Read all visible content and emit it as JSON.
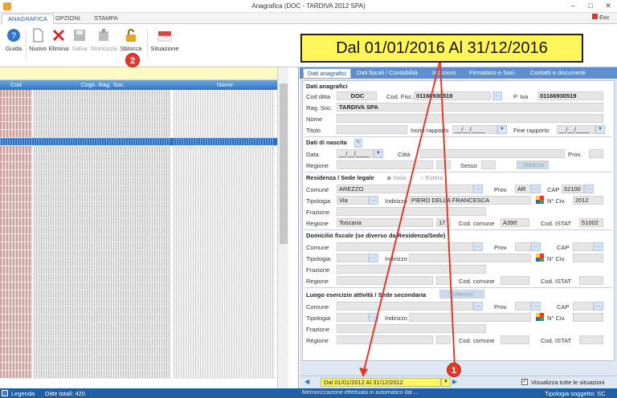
{
  "window": {
    "title": "Anagrafica (DOC - TARDIVA 2012 SPA)",
    "esc_label": "Esc"
  },
  "ribbon_tabs": [
    "ANAGRAFICA",
    "OPZIONI",
    "STAMPA"
  ],
  "ribbon_buttons": {
    "guida": "Guida",
    "nuovo": "Nuovo",
    "elimina": "Elimina",
    "salva": "Salva",
    "storicizza": "Storicizza",
    "sblocca": "Sblocca",
    "situazione": "Situazione"
  },
  "callout": {
    "text": "Dal 01/01/2016 Al 31/12/2016",
    "badge_1": "1",
    "badge_2": "2"
  },
  "grid": {
    "col_cod": "Cod",
    "col_rag": "Cogn. Rag. Soc.",
    "col_nome": "Nome"
  },
  "right_tabs": [
    "Dati anagrafici",
    "Dati fiscali / Contabilità",
    "Iscrizioni",
    "Firmatario e Soci",
    "Contatti e documenti"
  ],
  "dati_anagrafici": {
    "section": "Dati anagrafici",
    "cod_ditta_label": "Cod ditta",
    "cod_ditta": "DOC",
    "cod_fisc_label": "Cod. Fisc.",
    "cod_fisc": "01166930519",
    "piva_label": "P. Iva",
    "piva": "01166930519",
    "rag_soc_label": "Rag. Soc.",
    "rag_soc": "TARDIVA SPA",
    "nome_label": "Nome",
    "titolo_label": "Titolo",
    "inizio_label": "Inizio rapporto",
    "inizio_value": "__/__/____",
    "fine_label": "Fine rapporto",
    "fine_value": "__/__/____"
  },
  "nascita": {
    "section": "Dati di nascita",
    "data_label": "Data",
    "data_value": "__/__/____",
    "citta_label": "Città",
    "prov_label": "Prov.",
    "regione_label": "Regione",
    "sesso_label": "Sesso",
    "sblocca_btn": "Sblocca"
  },
  "residenza": {
    "section": "Residenza / Sede legale",
    "opt_italia": "Italia",
    "opt_estera": "Estera",
    "comune_label": "Comune",
    "comune": "AREZZO",
    "prov_label": "Prov.",
    "prov": "AR",
    "cap_label": "CAP",
    "cap": "52100",
    "tipologia_label": "Tipologia",
    "tipologia": "Via",
    "indirizzo_label": "Indirizzo",
    "indirizzo": "PIERO DELLA FRANCESCA",
    "civ_label": "N° Civ.",
    "civ": "2012",
    "frazione_label": "Frazione",
    "regione_label": "Regione",
    "regione": "Toscana",
    "regione_code": "17",
    "cod_comune_label": "Cod. comune",
    "cod_comune": "A390",
    "istat_label": "Cod. ISTAT",
    "istat": "51002"
  },
  "domicilio": {
    "section": "Domicilio fiscale (se diverso da Residenza/Sede)",
    "comune_label": "Comune",
    "prov_label": "Prov.",
    "cap_label": "CAP",
    "tipologia_label": "Tipologia",
    "indirizzo_label": "Indirizzo",
    "civ_label": "N° Civ.",
    "frazione_label": "Frazione",
    "regione_label": "Regione",
    "cod_comune_label": "Cod. comune",
    "istat_label": "Cod. ISTAT"
  },
  "luogo": {
    "section": "Luogo esercizio attività / Sede secondaria",
    "ulteriori": "Ulteriori",
    "comune_label": "Comune",
    "prov_label": "Prov.",
    "cap_label": "CAP",
    "tipologia_label": "Tipologia",
    "indirizzo_label": "Indirizzo",
    "civ_label": "N° Civ.",
    "frazione_label": "Frazione",
    "regione_label": "Regione",
    "cod_comune_label": "Cod. comune",
    "istat_label": "Cod. ISTAT"
  },
  "bottom_nav": {
    "period": "Dal 01/01/2012 Al 31/12/2012",
    "visualizza": "Visualizza tutte le situazioni"
  },
  "status": {
    "legenda": "Legenda",
    "ditte": "Ditte totali: 420",
    "msg": "Memorizzazione effettuata in automatico dal ...",
    "tipologia": "Tipologia soggetto: SC"
  }
}
